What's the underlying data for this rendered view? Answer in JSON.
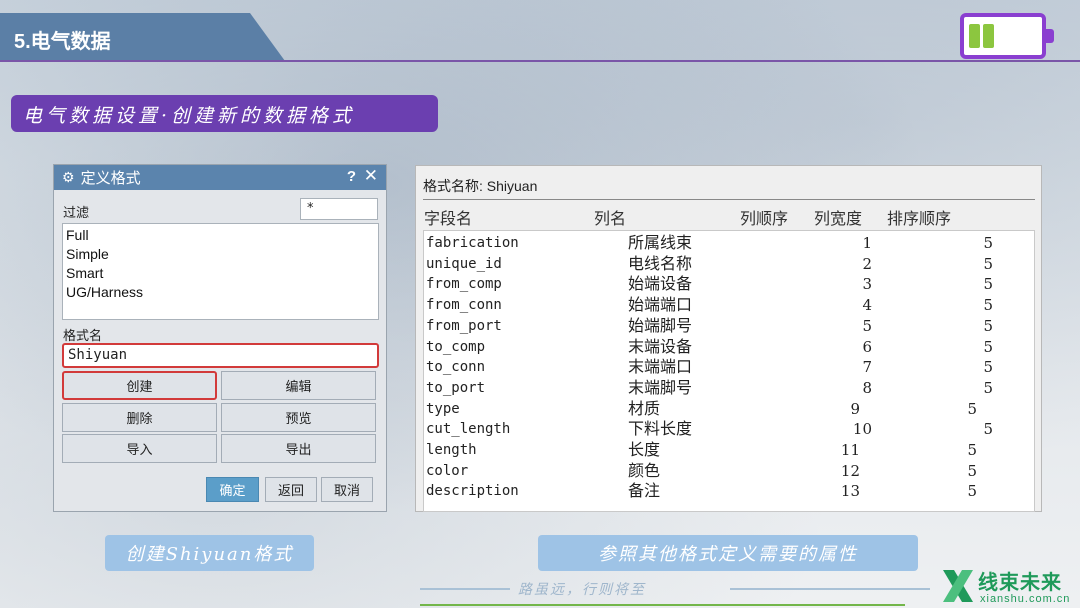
{
  "header": {
    "section_title": "5.电气数据",
    "subtitle": "电气数据设置·创建新的数据格式"
  },
  "battery_indicator": {
    "icon": "battery-icon",
    "color": "#8a3fd0",
    "fill_color": "#8cc63f",
    "filled_cells": 2
  },
  "dialog": {
    "title": "定义格式",
    "help_label": "?",
    "close_label": "✕",
    "filter_label": "过滤",
    "filter_value": "*",
    "list_items": [
      "Full",
      "Simple",
      "Smart",
      "UG/Harness"
    ],
    "name_label": "格式名",
    "name_value": "Shiyuan",
    "buttons": {
      "create": "创建",
      "edit": "编辑",
      "delete": "删除",
      "preview": "预览",
      "import": "导入",
      "export": "导出"
    },
    "footer_buttons": {
      "ok": "确定",
      "back": "返回",
      "cancel": "取消"
    },
    "highlight_color": "#d23a3a",
    "title_color": "#5b84ad"
  },
  "format_panel": {
    "format_name_line": "格式名称: Shiyuan",
    "headers": {
      "field": "字段名",
      "column": "列名",
      "order": "列顺序",
      "width": "列宽度",
      "sort": "排序顺序"
    },
    "rows": [
      {
        "field": "fabrication",
        "column": "所属线束",
        "order": "",
        "width": "1",
        "sort": "5"
      },
      {
        "field": "unique_id",
        "column": "电线名称",
        "order": "",
        "width": "2",
        "sort": "5"
      },
      {
        "field": "from_comp",
        "column": "始端设备",
        "order": "",
        "width": "3",
        "sort": "5"
      },
      {
        "field": "from_conn",
        "column": "始端端口",
        "order": "",
        "width": "4",
        "sort": "5"
      },
      {
        "field": "from_port",
        "column": "始端脚号",
        "order": "",
        "width": "5",
        "sort": "5"
      },
      {
        "field": "to_comp",
        "column": "末端设备",
        "order": "",
        "width": "6",
        "sort": "5"
      },
      {
        "field": "to_conn",
        "column": "末端端口",
        "order": "",
        "width": "7",
        "sort": "5"
      },
      {
        "field": "to_port",
        "column": "末端脚号",
        "order": "",
        "width": "8",
        "sort": "5"
      },
      {
        "field": "type",
        "column": "材质",
        "order": "9",
        "width": "",
        "sort": "5"
      },
      {
        "field": "cut_length",
        "column": "下料长度",
        "order": "",
        "width": "10",
        "sort": "5"
      },
      {
        "field": "length",
        "column": "长度",
        "order": "11",
        "width": "",
        "sort": "5"
      },
      {
        "field": "color",
        "column": "颜色",
        "order": "12",
        "width": "",
        "sort": "5"
      },
      {
        "field": "description",
        "column": "备注",
        "order": "13",
        "width": "",
        "sort": "5"
      }
    ]
  },
  "captions": {
    "left": "创建Shiyuan格式",
    "right": "参照其他格式定义需要的属性"
  },
  "footer": {
    "slogan": "路虽远，行则将至",
    "logo_name": "线束未来",
    "logo_url": "xianshu.com.cn",
    "logo_color": "#1f9a5a"
  }
}
